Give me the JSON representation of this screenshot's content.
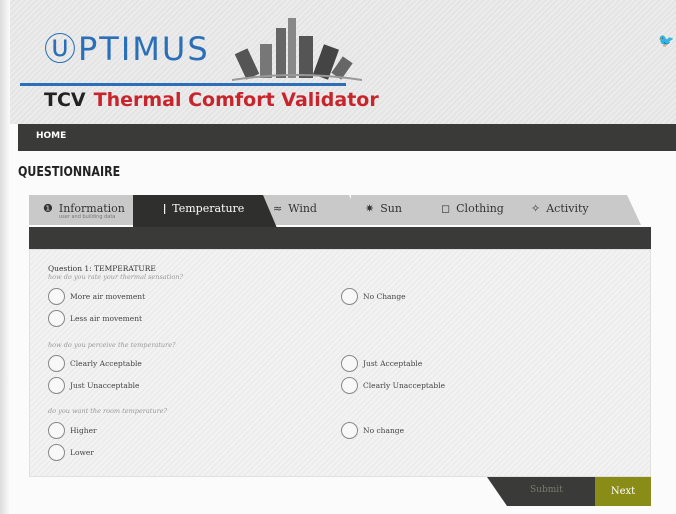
{
  "brand": {
    "name": "ⓊPTIMUS",
    "abbr": "TCV",
    "full_name": "Thermal Comfort Validator"
  },
  "social": {
    "twitter_icon": "twitter-bird-icon"
  },
  "nav": {
    "home": "HOME"
  },
  "page": {
    "title": "QUESTIONNAIRE"
  },
  "tabs": [
    {
      "label": "Information",
      "icon": "info-icon",
      "glyph": "❶",
      "sub": "user and building data"
    },
    {
      "label": "Temperature",
      "icon": "thermometer-icon",
      "glyph": "ǀ"
    },
    {
      "label": "Wind",
      "icon": "wind-icon",
      "glyph": "≈"
    },
    {
      "label": "Sun",
      "icon": "sun-icon",
      "glyph": "✷"
    },
    {
      "label": "Clothing",
      "icon": "clothing-icon",
      "glyph": "◻"
    },
    {
      "label": "Activity",
      "icon": "person-icon",
      "glyph": "✧"
    }
  ],
  "question": {
    "title": "Question 1: TEMPERATURE",
    "prompts": [
      "how do you rate your thermal sensation?",
      "how do you perceive the temperature?",
      "do you want the room temperature?"
    ],
    "groups": [
      [
        "More air movement",
        "No Change",
        "Less air movement"
      ],
      [
        "Clearly Acceptable",
        "Just Acceptable",
        "Just Unacceptable",
        "Clearly Unacceptable"
      ],
      [
        "Higher",
        "No change",
        "Lower"
      ]
    ]
  },
  "buttons": {
    "submit": "Submit",
    "next": "Next"
  },
  "colors": {
    "brand_blue": "#2a6fb8",
    "title_red": "#c8242c",
    "next_olive": "#8a8c18",
    "dark_bar": "#3a3a38"
  }
}
